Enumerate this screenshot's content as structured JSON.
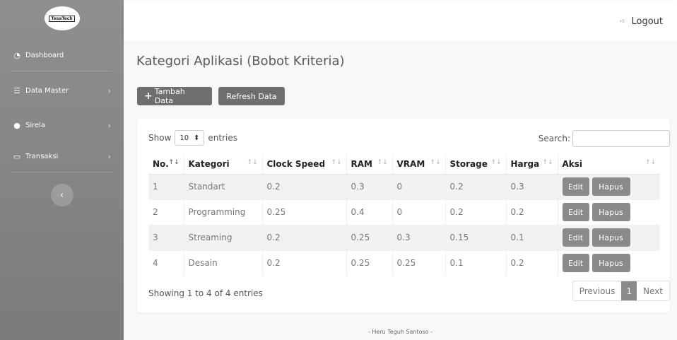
{
  "brand": {
    "logo_text": "TesaTech"
  },
  "sidebar": {
    "items": [
      {
        "label": "Dashboard",
        "has_arrow": false
      },
      {
        "label": "Data Master",
        "has_arrow": true
      },
      {
        "label": "Sirela",
        "has_arrow": true
      },
      {
        "label": "Transaksi",
        "has_arrow": true
      }
    ],
    "arrow": "›",
    "toggle": "‹"
  },
  "topbar": {
    "logout_label": "Logout"
  },
  "page": {
    "title": "Kategori Aplikasi (Bobot Kriteria)",
    "add_button": "Tambah Data",
    "refresh_button": "Refresh Data"
  },
  "table_controls": {
    "show_label": "Show",
    "entries_value": "10",
    "entries_label": "entries",
    "search_label": "Search:",
    "search_value": ""
  },
  "table": {
    "headers": [
      "No.",
      "Kategori",
      "Clock Speed",
      "RAM",
      "VRAM",
      "Storage",
      "Harga",
      "Aksi"
    ],
    "rows": [
      [
        "1",
        "Standart",
        "0.2",
        "0.3",
        "0",
        "0.2",
        "0.3"
      ],
      [
        "2",
        "Programming",
        "0.25",
        "0.4",
        "0",
        "0.2",
        "0.2"
      ],
      [
        "3",
        "Streaming",
        "0.2",
        "0.25",
        "0.3",
        "0.15",
        "0.1"
      ],
      [
        "4",
        "Desain",
        "0.2",
        "0.25",
        "0.25",
        "0.1",
        "0.2"
      ]
    ],
    "edit_label": "Edit",
    "hapus_label": "Hapus"
  },
  "pagination": {
    "info": "Showing 1 to 4 of 4 entries",
    "previous": "Previous",
    "current": "1",
    "next": "Next"
  },
  "footer": {
    "text": "- Heru Teguh Santoso -"
  },
  "colors": {
    "sidebar": "#8a8a8a",
    "button": "#6f6f6f",
    "action": "#8a8a8a"
  }
}
